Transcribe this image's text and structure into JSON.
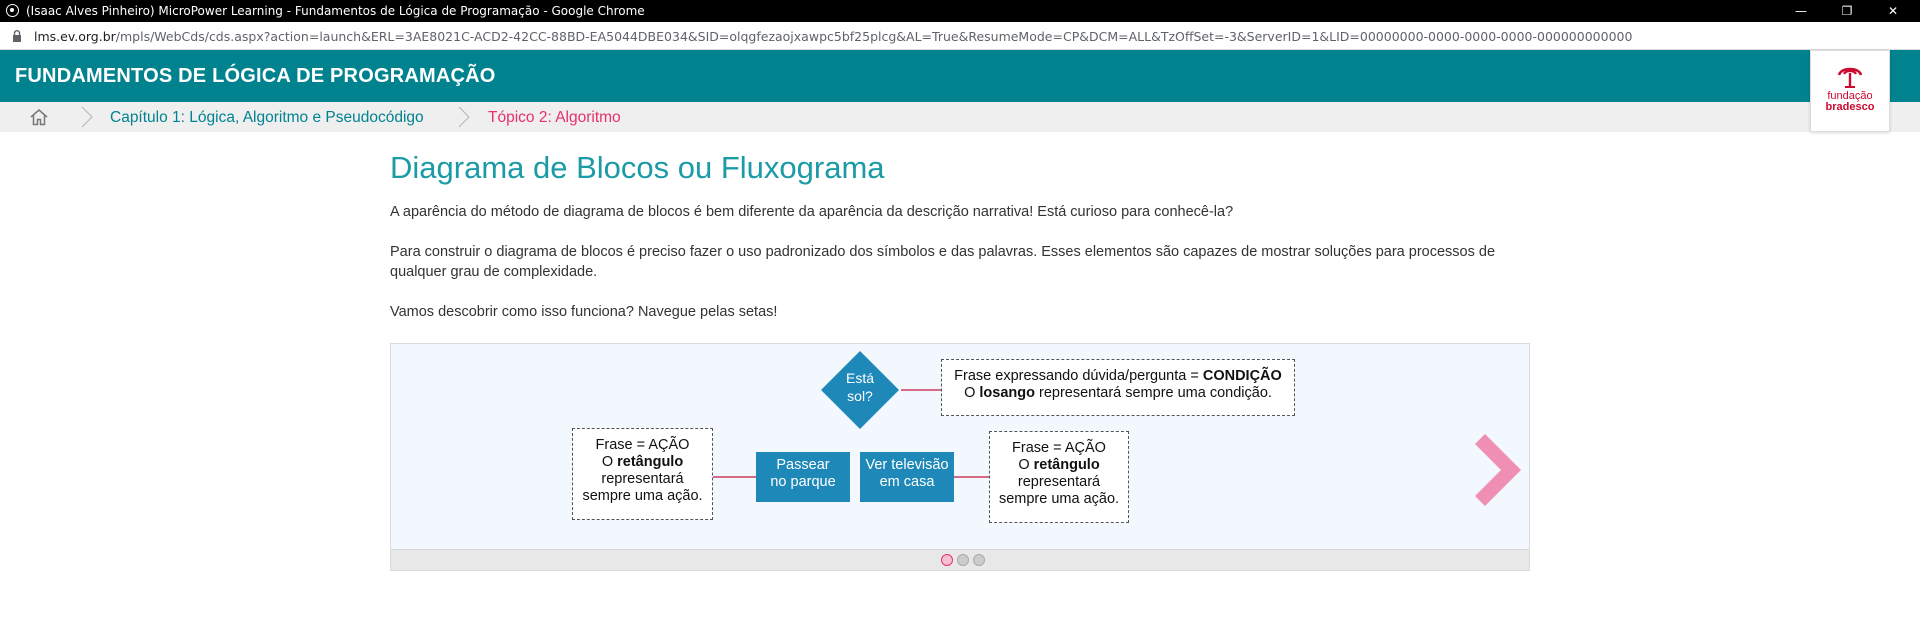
{
  "browser": {
    "window_title": "(Isaac Alves Pinheiro) MicroPower Learning - Fundamentos de Lógica de Programação - Google Chrome",
    "url_host": "lms.ev.org.br",
    "url_path": "/mpls/WebCds/cds.aspx?action=launch&ERL=3AE8021C-ACD2-42CC-88BD-EA5044DBE034&SID=olqgfezaojxawpc5bf25plcg&AL=True&ResumeMode=CP&DCM=ALL&TzOffSet=-3&ServerID=1&LID=00000000-0000-0000-0000-000000000000",
    "minimize_label": "—",
    "restore_label": "❐",
    "close_label": "✕"
  },
  "header": {
    "course_title": "FUNDAMENTOS DE LÓGICA DE PROGRAMAÇÃO",
    "color": "#00838f"
  },
  "logo": {
    "line1": "fundação",
    "line2": "bradesco",
    "color": "#cc092f"
  },
  "breadcrumb": {
    "items": [
      {
        "label": "Capítulo 1: Lógica, Algoritmo e Pseudocódigo"
      },
      {
        "label": "Tópico 2: Algoritmo"
      }
    ]
  },
  "content": {
    "title": "Diagrama de Blocos ou Fluxograma",
    "paragraphs": [
      "A aparência do método de diagrama de blocos é bem diferente da aparência da descrição narrativa! Está curioso para conhecê-la?",
      "Para construir o diagrama de blocos é preciso fazer o uso padronizado dos símbolos e das palavras. Esses elementos são capazes de mostrar soluções para processos de qualquer grau de complexidade.",
      "Vamos descobrir como isso funciona? Navegue pelas setas!"
    ]
  },
  "diagram": {
    "decision": {
      "line1": "Está",
      "line2": "sol?"
    },
    "condition_note": {
      "line1_prefix": "Frase expressando dúvida/pergunta = ",
      "line1_bold": "CONDIÇÃO",
      "line2_prefix": "O ",
      "line2_bold": "losango",
      "line2_suffix": " representará sempre uma condição."
    },
    "action_note_left": {
      "line1": "Frase = AÇÃO",
      "line2_prefix": "O ",
      "line2_bold": "retângulo",
      "line3": "representará",
      "line4": "sempre uma ação."
    },
    "action_note_right": {
      "line1": "Frase = AÇÃO",
      "line2_prefix": "O ",
      "line2_bold": "retângulo",
      "line3": "representará",
      "line4": "sempre uma ação."
    },
    "actions": [
      {
        "line1": "Passear",
        "line2": "no parque"
      },
      {
        "line1": "Ver televisão",
        "line2": "em casa"
      }
    ],
    "pager": {
      "count": 3,
      "active": 0
    },
    "colors": {
      "shape": "#1e88b9",
      "connector": "#d66a87",
      "arrow": "#ee8fb3"
    }
  }
}
